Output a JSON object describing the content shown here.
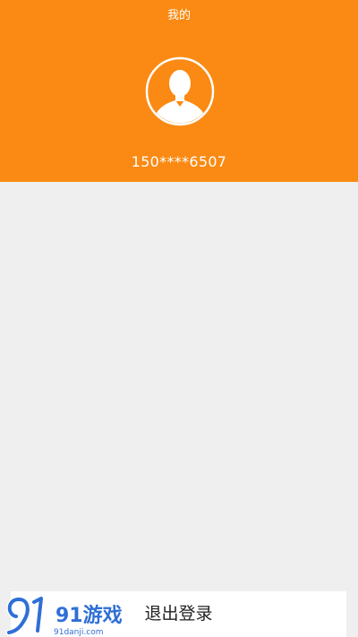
{
  "header": {
    "title": "我的",
    "phone": "150****6507",
    "background_color": "#fa8a13",
    "avatar_icon": "user-avatar-icon"
  },
  "logout": {
    "label": "退出登录"
  },
  "watermark": {
    "brand_text": "91游戏",
    "site_text": "91danji.com"
  }
}
